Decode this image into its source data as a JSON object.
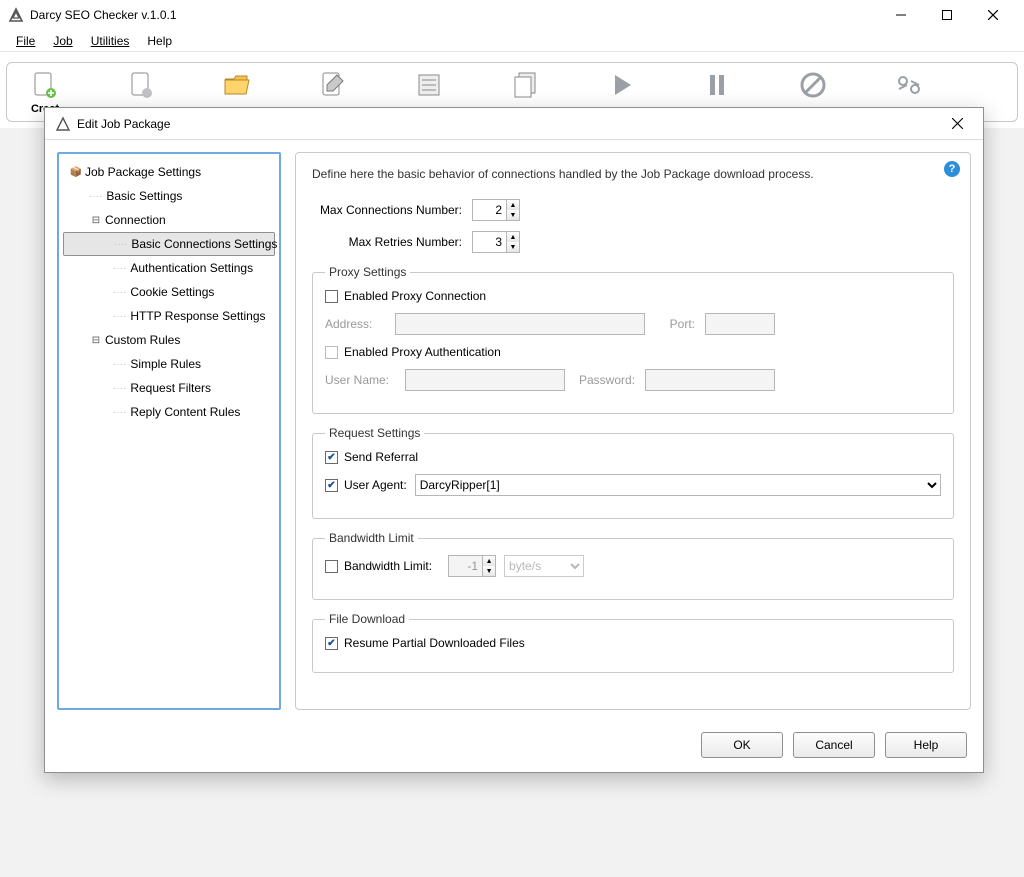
{
  "window": {
    "title": "Darcy SEO Checker v.1.0.1"
  },
  "menubar": {
    "file": "File",
    "job": "Job",
    "utilities": "Utilities",
    "help": "Help"
  },
  "toolbar": {
    "create_label": "Creat"
  },
  "dialog": {
    "title": "Edit Job Package",
    "description": "Define here the basic behavior of connections handled by the Job Package download process.",
    "tree": {
      "root": "Job Package Settings",
      "basic_settings": "Basic Settings",
      "connection": "Connection",
      "basic_conn": "Basic Connections Settings",
      "auth": "Authentication Settings",
      "cookie": "Cookie Settings",
      "http_resp": "HTTP Response Settings",
      "custom_rules": "Custom Rules",
      "simple_rules": "Simple Rules",
      "req_filters": "Request Filters",
      "reply_rules": "Reply Content Rules"
    },
    "fields": {
      "max_conn_label": "Max Connections Number:",
      "max_conn_value": "2",
      "max_retries_label": "Max Retries Number:",
      "max_retries_value": "3"
    },
    "proxy": {
      "legend": "Proxy Settings",
      "enable": "Enabled Proxy Connection",
      "address_label": "Address:",
      "port_label": "Port:",
      "enable_auth": "Enabled Proxy Authentication",
      "user_label": "User Name:",
      "pass_label": "Password:"
    },
    "request": {
      "legend": "Request Settings",
      "send_referral": "Send Referral",
      "user_agent_label": "User Agent:",
      "user_agent_value": "DarcyRipper[1]"
    },
    "bandwidth": {
      "legend": "Bandwidth Limit",
      "enable": "Bandwidth Limit:",
      "value": "-1",
      "unit": "byte/s"
    },
    "filedl": {
      "legend": "File Download",
      "resume": "Resume Partial Downloaded Files"
    },
    "buttons": {
      "ok": "OK",
      "cancel": "Cancel",
      "help": "Help"
    }
  }
}
